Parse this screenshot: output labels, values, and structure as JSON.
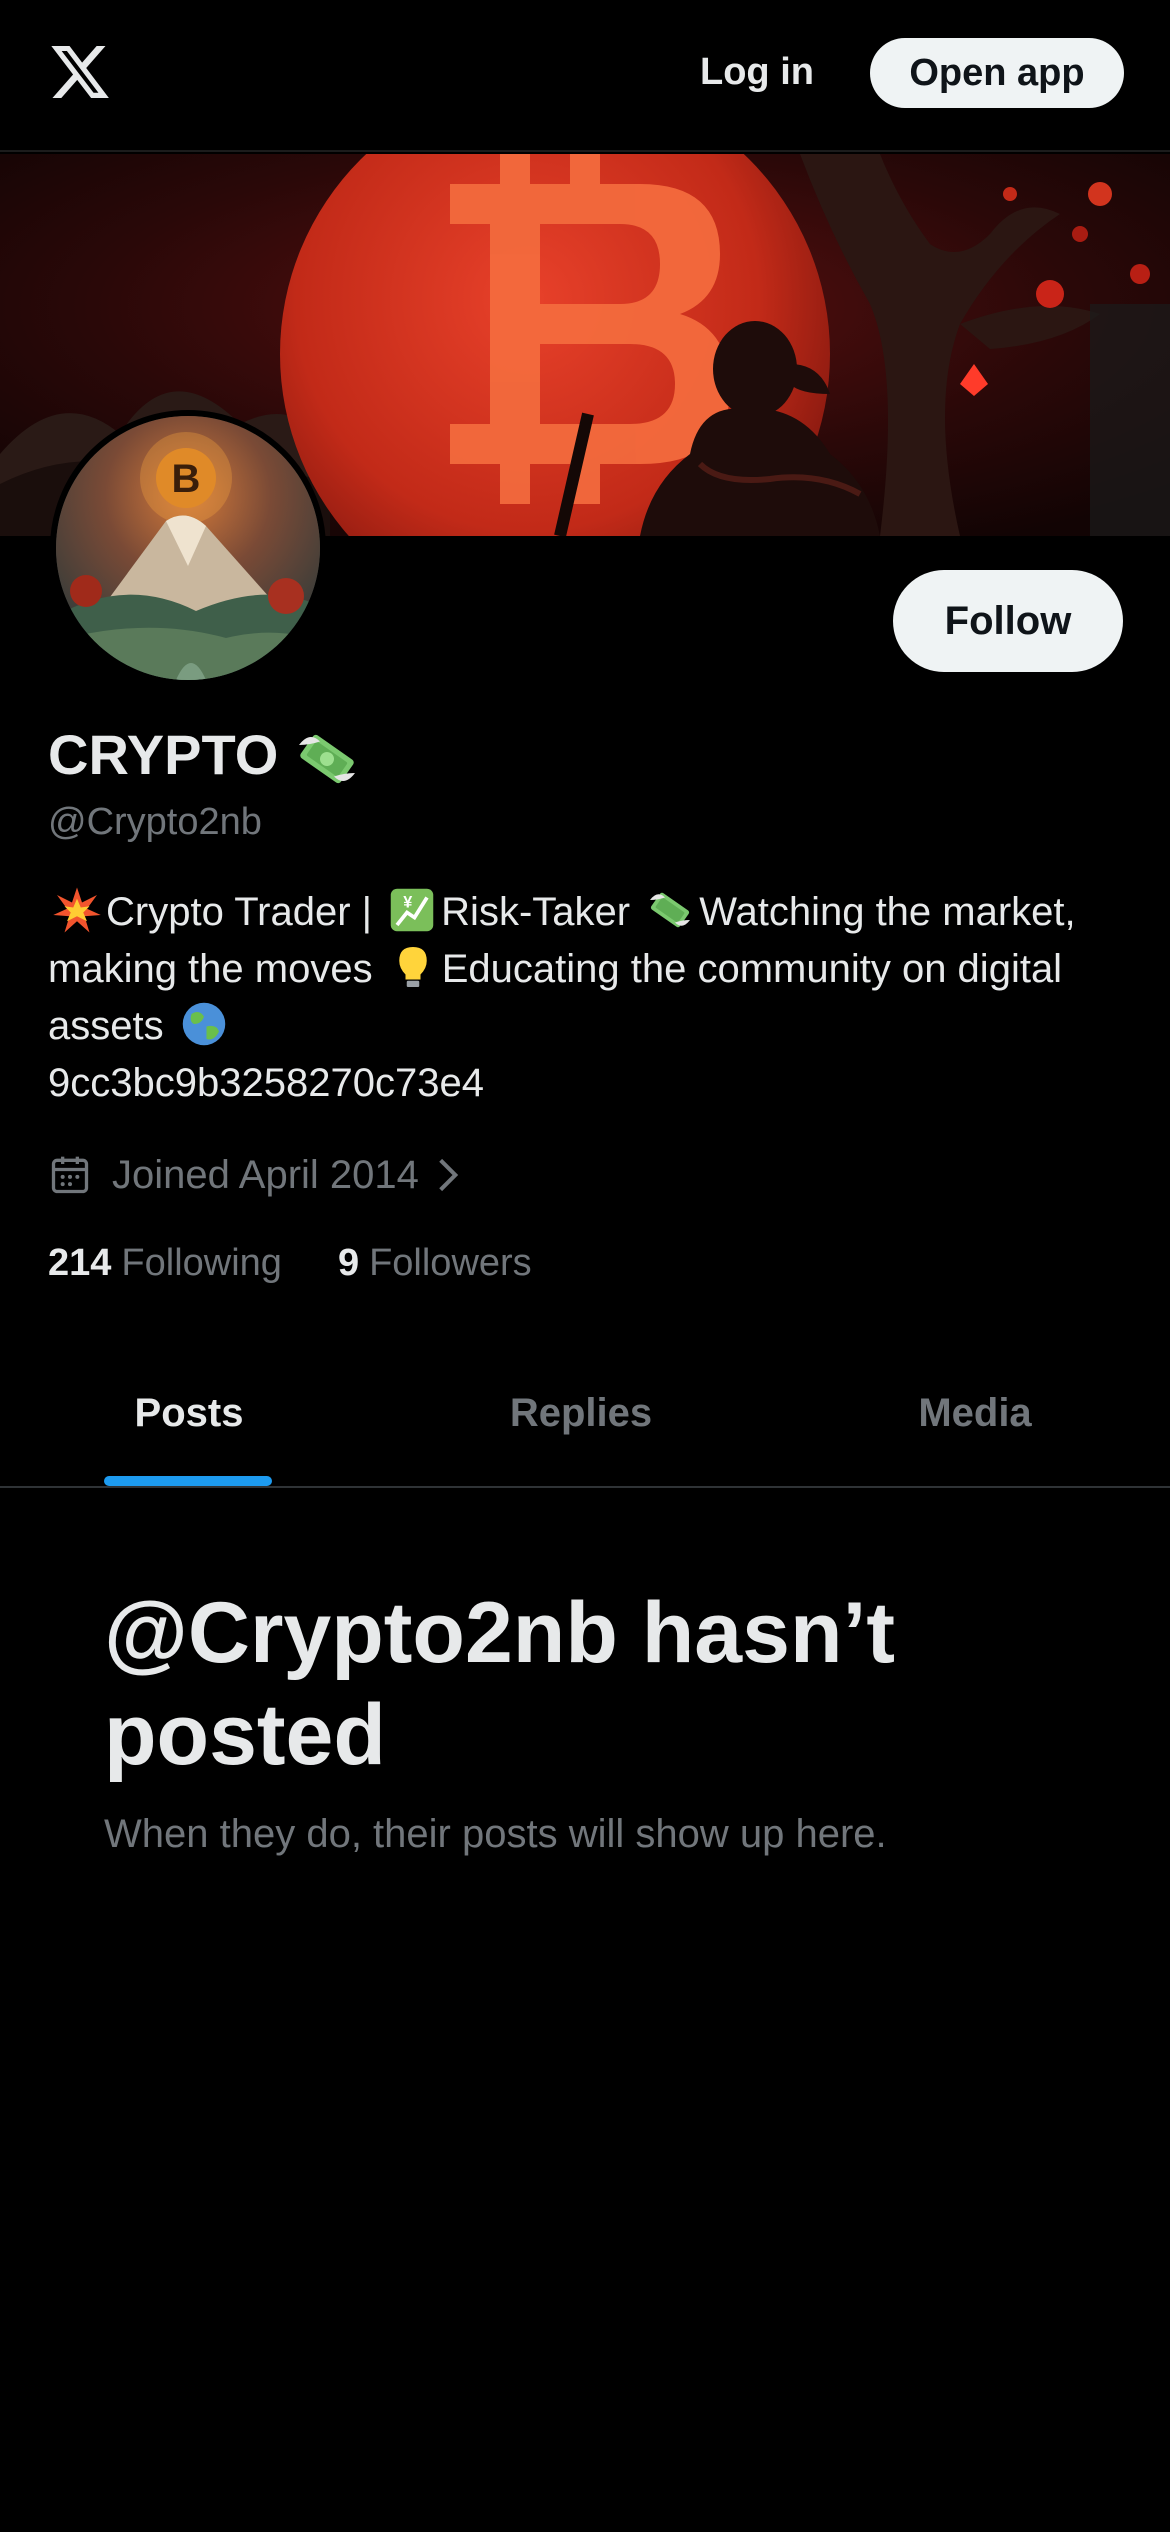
{
  "header": {
    "login_label": "Log in",
    "open_app_label": "Open app"
  },
  "profile": {
    "display_name": "CRYPTO",
    "handle": "@Crypto2nb",
    "follow_label": "Follow",
    "bio": {
      "seg1": "Crypto Trader |",
      "seg2": "Risk-Taker",
      "seg3": "Watching the market, making the moves",
      "seg4": "Educating the community on digital assets",
      "seg5": "9cc3bc9b3258270c73e4"
    },
    "joined": "Joined April 2014",
    "following_count": "214",
    "following_label": "Following",
    "followers_count": "9",
    "followers_label": "Followers"
  },
  "tabs": [
    {
      "label": "Posts",
      "active": true
    },
    {
      "label": "Replies",
      "active": false
    },
    {
      "label": "Media",
      "active": false
    }
  ],
  "empty_state": {
    "title": "@Crypto2nb hasn’t posted",
    "subtitle": "When they do, their posts will show up here."
  },
  "colors": {
    "background": "#000000",
    "text_primary": "#e7e9ea",
    "text_secondary": "#71767b",
    "accent": "#1d9bf0",
    "button_light": "#eff3f4"
  },
  "icons": [
    "x-logo-icon",
    "calendar-icon",
    "chevron-right-icon",
    "money-wings-icon",
    "collision-icon",
    "chart-yen-icon",
    "lightbulb-icon",
    "globe-icon"
  ]
}
